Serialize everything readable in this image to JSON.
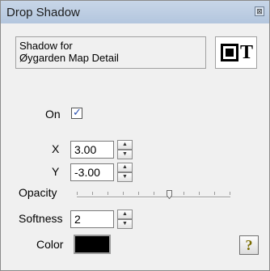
{
  "window": {
    "title": "Drop Shadow",
    "close_glyph": "⊠"
  },
  "header": {
    "line1": "Shadow for",
    "line2": "Øygarden Map Detail",
    "preview_letter": "T",
    "preview_icon": "frame-text-icon"
  },
  "on": {
    "label": "On",
    "checked": true,
    "check_glyph": "✓"
  },
  "offset": {
    "x_label": "X",
    "x_value": "3.00",
    "y_label": "Y",
    "y_value": "-3.00"
  },
  "opacity": {
    "label": "Opacity",
    "level": 0.6
  },
  "softness": {
    "label": "Softness",
    "value": "2"
  },
  "color": {
    "label": "Color",
    "value": "#000000"
  },
  "help": {
    "glyph": "?",
    "icon": "help-icon"
  },
  "spinner": {
    "up_glyph": "▲",
    "down_glyph": "▼"
  }
}
